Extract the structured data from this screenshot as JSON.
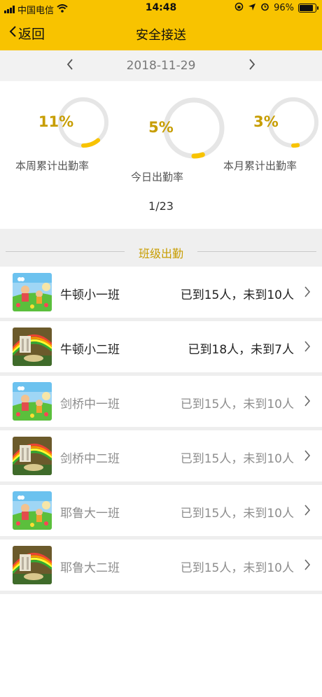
{
  "status_bar": {
    "carrier": "中国电信",
    "time": "14:48",
    "battery": "96%",
    "battery_level": 0.96
  },
  "nav": {
    "back_label": "返回",
    "title": "安全接送"
  },
  "date_bar": {
    "date": "2018-11-29"
  },
  "stats": [
    {
      "pct_label": "11%",
      "value": 0.11,
      "label": "本周累计出勤率"
    },
    {
      "pct_label": "5%",
      "value": 0.05,
      "label": "今日出勤率"
    },
    {
      "pct_label": "3%",
      "value": 0.03,
      "label": "本月累计出勤率"
    }
  ],
  "ratio": "1/23",
  "section_title": "班级出勤",
  "classes": [
    {
      "name": "牛顿小一班",
      "status": "已到15人，未到10人",
      "active": true,
      "thumb": "kids-playground"
    },
    {
      "name": "牛顿小二班",
      "status": "已到18人，未到7人",
      "active": true,
      "thumb": "garden-rainbow"
    },
    {
      "name": "剑桥中一班",
      "status": "已到15人，未到10人",
      "active": false,
      "thumb": "kids-playground"
    },
    {
      "name": "剑桥中二班",
      "status": "已到15人，未到10人",
      "active": false,
      "thumb": "garden-rainbow"
    },
    {
      "name": "耶鲁大一班",
      "status": "已到15人，未到10人",
      "active": false,
      "thumb": "kids-playground"
    },
    {
      "name": "耶鲁大二班",
      "status": "已到15人，未到10人",
      "active": false,
      "thumb": "garden-rainbow"
    }
  ],
  "colors": {
    "brand": "#f8c300",
    "accent_text": "#c79d00",
    "ring_track": "#e6e6e6",
    "ring_progress": "#f8c300"
  }
}
